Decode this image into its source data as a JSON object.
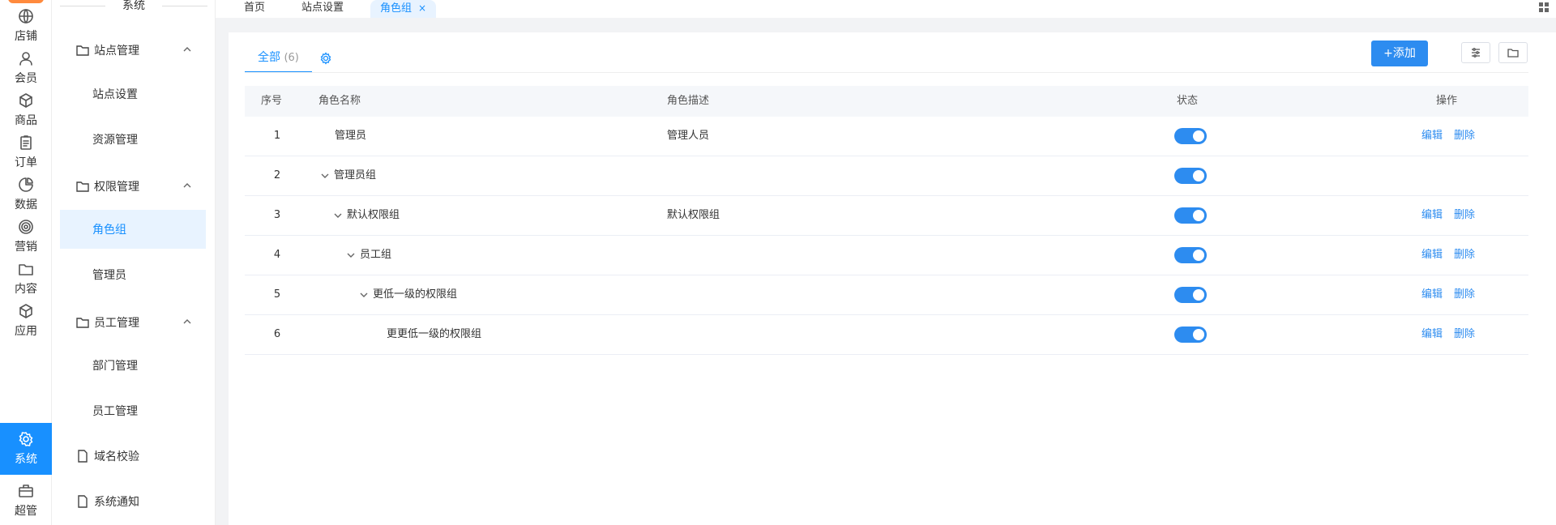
{
  "rail": {
    "items": [
      {
        "label": "店铺",
        "icon": "globe-icon"
      },
      {
        "label": "会员",
        "icon": "user-icon"
      },
      {
        "label": "商品",
        "icon": "cube-icon"
      },
      {
        "label": "订单",
        "icon": "clipboard-icon"
      },
      {
        "label": "数据",
        "icon": "pie-chart-icon"
      },
      {
        "label": "营销",
        "icon": "target-icon"
      },
      {
        "label": "内容",
        "icon": "folder-icon"
      },
      {
        "label": "应用",
        "icon": "box-icon"
      },
      {
        "label": "系统",
        "icon": "gear-icon"
      },
      {
        "label": "超管",
        "icon": "briefcase-icon"
      }
    ],
    "active_index": 8
  },
  "sidebar": {
    "title": "系统",
    "groups": [
      {
        "label": "站点管理",
        "children": [
          "站点设置",
          "资源管理"
        ]
      },
      {
        "label": "权限管理",
        "children": [
          "角色组",
          "管理员"
        ]
      },
      {
        "label": "员工管理",
        "children": [
          "部门管理",
          "员工管理"
        ]
      }
    ],
    "singles": [
      "域名校验",
      "系统通知"
    ],
    "active_item": "角色组"
  },
  "tabbar": {
    "tabs": [
      "首页",
      "站点设置",
      "角色组"
    ],
    "active_tab": "角色组",
    "close_icon": "×"
  },
  "content": {
    "tab_all_label": "全部",
    "tab_all_count": "(6)",
    "add_button": "+添加",
    "columns": [
      "序号",
      "角色名称",
      "角色描述",
      "状态",
      "操作"
    ],
    "rows": [
      {
        "index": "1",
        "name": "管理员",
        "desc": "管理人员",
        "level": 0,
        "expandable": false,
        "enabled": true,
        "edit": "编辑",
        "delete": "删除"
      },
      {
        "index": "2",
        "name": "管理员组",
        "desc": "",
        "level": 0,
        "expandable": true,
        "enabled": true,
        "edit": "",
        "delete": ""
      },
      {
        "index": "3",
        "name": "默认权限组",
        "desc": "默认权限组",
        "level": 1,
        "expandable": true,
        "enabled": true,
        "edit": "编辑",
        "delete": "删除"
      },
      {
        "index": "4",
        "name": "员工组",
        "desc": "",
        "level": 2,
        "expandable": true,
        "enabled": true,
        "edit": "编辑",
        "delete": "删除"
      },
      {
        "index": "5",
        "name": "更低一级的权限组",
        "desc": "",
        "level": 3,
        "expandable": true,
        "enabled": true,
        "edit": "编辑",
        "delete": "删除"
      },
      {
        "index": "6",
        "name": "更更低一级的权限组",
        "desc": "",
        "level": 4,
        "expandable": false,
        "enabled": true,
        "edit": "编辑",
        "delete": "删除"
      }
    ]
  },
  "colors": {
    "accent": "#1890ff",
    "switch_on": "#2d8cf0",
    "active_bg": "#e8f3ff"
  }
}
